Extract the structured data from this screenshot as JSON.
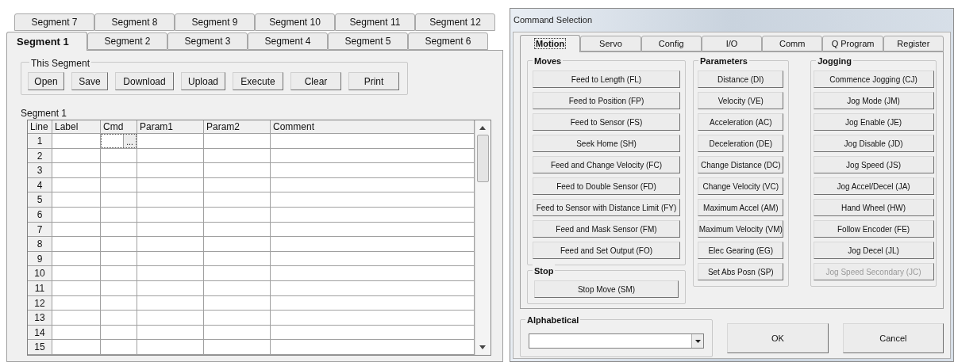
{
  "segment_editor": {
    "tab_rows": [
      [
        {
          "label": "Segment 7",
          "selected": false
        },
        {
          "label": "Segment 8",
          "selected": false
        },
        {
          "label": "Segment 9",
          "selected": false
        },
        {
          "label": "Segment 10",
          "selected": false
        },
        {
          "label": "Segment 11",
          "selected": false
        },
        {
          "label": "Segment 12",
          "selected": false
        }
      ],
      [
        {
          "label": "Segment 1",
          "selected": true
        },
        {
          "label": "Segment 2",
          "selected": false
        },
        {
          "label": "Segment 3",
          "selected": false
        },
        {
          "label": "Segment 4",
          "selected": false
        },
        {
          "label": "Segment 5",
          "selected": false
        },
        {
          "label": "Segment 6",
          "selected": false
        }
      ]
    ],
    "group": {
      "title": "This Segment",
      "buttons": [
        "Open",
        "Save",
        "Download",
        "Upload",
        "Execute",
        "Clear",
        "Print"
      ]
    },
    "grid_title": "Segment 1",
    "table": {
      "columns": [
        "Line",
        "Label",
        "Cmd",
        "Param1",
        "Param2",
        "Comment"
      ],
      "rows": [
        {
          "line": "1",
          "editing": true,
          "editor_button": "..."
        },
        {
          "line": "2",
          "editing": false
        },
        {
          "line": "3",
          "editing": false
        },
        {
          "line": "4",
          "editing": false
        },
        {
          "line": "5",
          "editing": false
        },
        {
          "line": "6",
          "editing": false
        },
        {
          "line": "7",
          "editing": false
        },
        {
          "line": "8",
          "editing": false
        },
        {
          "line": "9",
          "editing": false
        },
        {
          "line": "10",
          "editing": false
        },
        {
          "line": "11",
          "editing": false
        },
        {
          "line": "12",
          "editing": false
        },
        {
          "line": "13",
          "editing": false
        },
        {
          "line": "14",
          "editing": false
        },
        {
          "line": "15",
          "editing": false
        }
      ]
    }
  },
  "command_selection": {
    "title": "Command Selection",
    "tabs": [
      {
        "label": "Motion",
        "selected": true
      },
      {
        "label": "Servo",
        "selected": false
      },
      {
        "label": "Config",
        "selected": false
      },
      {
        "label": "I/O",
        "selected": false
      },
      {
        "label": "Comm",
        "selected": false
      },
      {
        "label": "Q Program",
        "selected": false
      },
      {
        "label": "Register",
        "selected": false
      }
    ],
    "groups": [
      {
        "title": "Moves",
        "buttons": [
          {
            "label": "Feed to Length (FL)",
            "disabled": false
          },
          {
            "label": "Feed to Position (FP)",
            "disabled": false
          },
          {
            "label": "Feed to Sensor (FS)",
            "disabled": false
          },
          {
            "label": "Seek Home (SH)",
            "disabled": false
          },
          {
            "label": "Feed and Change Velocity (FC)",
            "disabled": false
          },
          {
            "label": "Feed to Double Sensor (FD)",
            "disabled": false
          },
          {
            "label": "Feed to Sensor with Distance Limit (FY)",
            "disabled": false
          },
          {
            "label": "Feed and Mask Sensor (FM)",
            "disabled": false
          },
          {
            "label": "Feed and Set Output (FO)",
            "disabled": false
          }
        ]
      },
      {
        "title": "Stop",
        "buttons": [
          {
            "label": "Stop Move (SM)",
            "disabled": false
          }
        ]
      },
      {
        "title": "Parameters",
        "buttons": [
          {
            "label": "Distance (DI)",
            "disabled": false
          },
          {
            "label": "Velocity (VE)",
            "disabled": false
          },
          {
            "label": "Acceleration (AC)",
            "disabled": false
          },
          {
            "label": "Deceleration (DE)",
            "disabled": false
          },
          {
            "label": "Change Distance (DC)",
            "disabled": false
          },
          {
            "label": "Change Velocity (VC)",
            "disabled": false
          },
          {
            "label": "Maximum Accel (AM)",
            "disabled": false
          },
          {
            "label": "Maximum Velocity (VM)",
            "disabled": false
          },
          {
            "label": "Elec Gearing (EG)",
            "disabled": false
          },
          {
            "label": "Set Abs Posn (SP)",
            "disabled": false
          }
        ]
      },
      {
        "title": "Jogging",
        "buttons": [
          {
            "label": "Commence Jogging (CJ)",
            "disabled": false
          },
          {
            "label": "Jog Mode (JM)",
            "disabled": false
          },
          {
            "label": "Jog Enable (JE)",
            "disabled": false
          },
          {
            "label": "Jog Disable (JD)",
            "disabled": false
          },
          {
            "label": "Jog Speed (JS)",
            "disabled": false
          },
          {
            "label": "Jog Accel/Decel (JA)",
            "disabled": false
          },
          {
            "label": "Hand Wheel (HW)",
            "disabled": false
          },
          {
            "label": "Follow Encoder (FE)",
            "disabled": false
          },
          {
            "label": "Jog Decel (JL)",
            "disabled": false
          },
          {
            "label": "Jog Speed Secondary (JC)",
            "disabled": true
          }
        ]
      }
    ],
    "alphabetical": {
      "label": "Alphabetical"
    },
    "buttons": [
      "OK",
      "Cancel"
    ]
  }
}
